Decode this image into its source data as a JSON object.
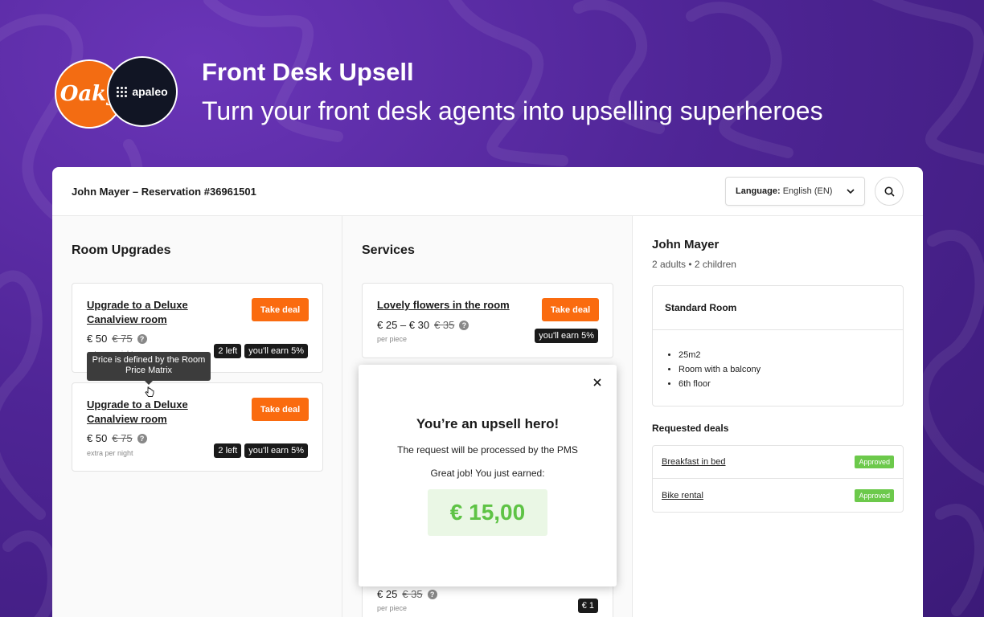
{
  "hero": {
    "logo_oaky": "Oaky",
    "logo_apaleo": "apaleo",
    "title": "Front Desk Upsell",
    "subtitle": "Turn your front desk agents into upselling superheroes"
  },
  "header": {
    "reservation": "John Mayer – Reservation #36961501",
    "language_label": "Language:",
    "language_value": "English (EN)"
  },
  "room_upgrades": {
    "title": "Room Upgrades",
    "tooltip": "Price is defined by the Room Price Matrix",
    "cards": [
      {
        "name": "Upgrade to a Deluxe Canalview room",
        "button": "Take deal",
        "price": "€ 50",
        "old_price": "€ 75",
        "note": "extra per night",
        "badge_left": "2 left",
        "badge_earn": "you'll earn 5%"
      },
      {
        "name": "Upgrade to a Deluxe Canalview room",
        "button": "Take deal",
        "price": "€ 50",
        "old_price": "€ 75",
        "note": "extra per night",
        "badge_left": "2 left",
        "badge_earn": "you'll earn 5%"
      }
    ]
  },
  "services": {
    "title": "Services",
    "cards": [
      {
        "name": "Lovely flowers in the room",
        "button": "Take deal",
        "price": "€ 25 – € 30",
        "old_price": "€ 35",
        "note": "per piece",
        "badge_earn": "you'll earn 5%"
      },
      {
        "price": "€ 25",
        "old_price": "€ 35",
        "note": "per piece",
        "badge_earn": "€ 1"
      }
    ]
  },
  "modal": {
    "title": "You’re an upsell hero!",
    "line1": "The request will be processed by the PMS",
    "line2": "Great job! You just earned:",
    "amount": "€ 15,00"
  },
  "guest": {
    "name": "John Mayer",
    "occupancy": "2 adults • 2 children",
    "room_type": "Standard Room",
    "features": [
      "25m2",
      "Room with a balcony",
      "6th floor"
    ],
    "requested_title": "Requested deals",
    "requested": [
      {
        "name": "Breakfast in bed",
        "status": "Approved"
      },
      {
        "name": "Bike rental",
        "status": "Approved"
      }
    ]
  },
  "icons": [
    "chevron-down-icon",
    "search-icon",
    "question-icon",
    "close-icon",
    "pointer-cursor-icon"
  ],
  "colors": {
    "accent_orange": "#fa6b0f",
    "approved_green": "#6cc94b",
    "earn_green": "#5ec345",
    "purple_bg": "#4f2596"
  }
}
